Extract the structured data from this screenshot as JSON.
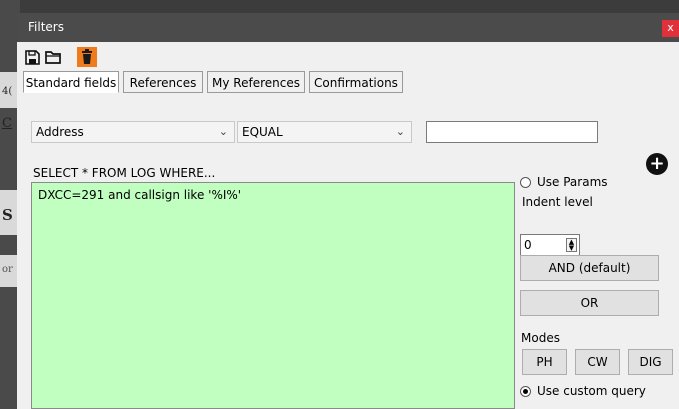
{
  "background_app": {
    "fragments": [
      "4(",
      "C",
      "S",
      "or"
    ]
  },
  "window": {
    "title": "Filters",
    "close_label": "x"
  },
  "toolbar": {
    "icons": [
      "save-icon",
      "open-folder-icon",
      "delete-icon"
    ],
    "delete_color": "#f07b1a"
  },
  "tabs": [
    {
      "label": "Standard fields",
      "active": true
    },
    {
      "label": "References",
      "active": false
    },
    {
      "label": "My References",
      "active": false
    },
    {
      "label": "Confirmations",
      "active": false
    }
  ],
  "filter": {
    "field_value": "Address",
    "operator_value": "EQUAL",
    "value_text": ""
  },
  "query": {
    "label": "SELECT * FROM LOG WHERE...",
    "text": "DXCC=291 and callsign like '%I%'",
    "background": "#c0ffc0"
  },
  "options": {
    "use_params_label": "Use Params",
    "indent_label": "Indent level",
    "indent_value": "0",
    "and_label": "AND (default)",
    "or_label": "OR",
    "modes_label": "Modes",
    "modes": [
      "PH",
      "CW",
      "DIG"
    ],
    "custom_query_label": "Use custom query"
  }
}
